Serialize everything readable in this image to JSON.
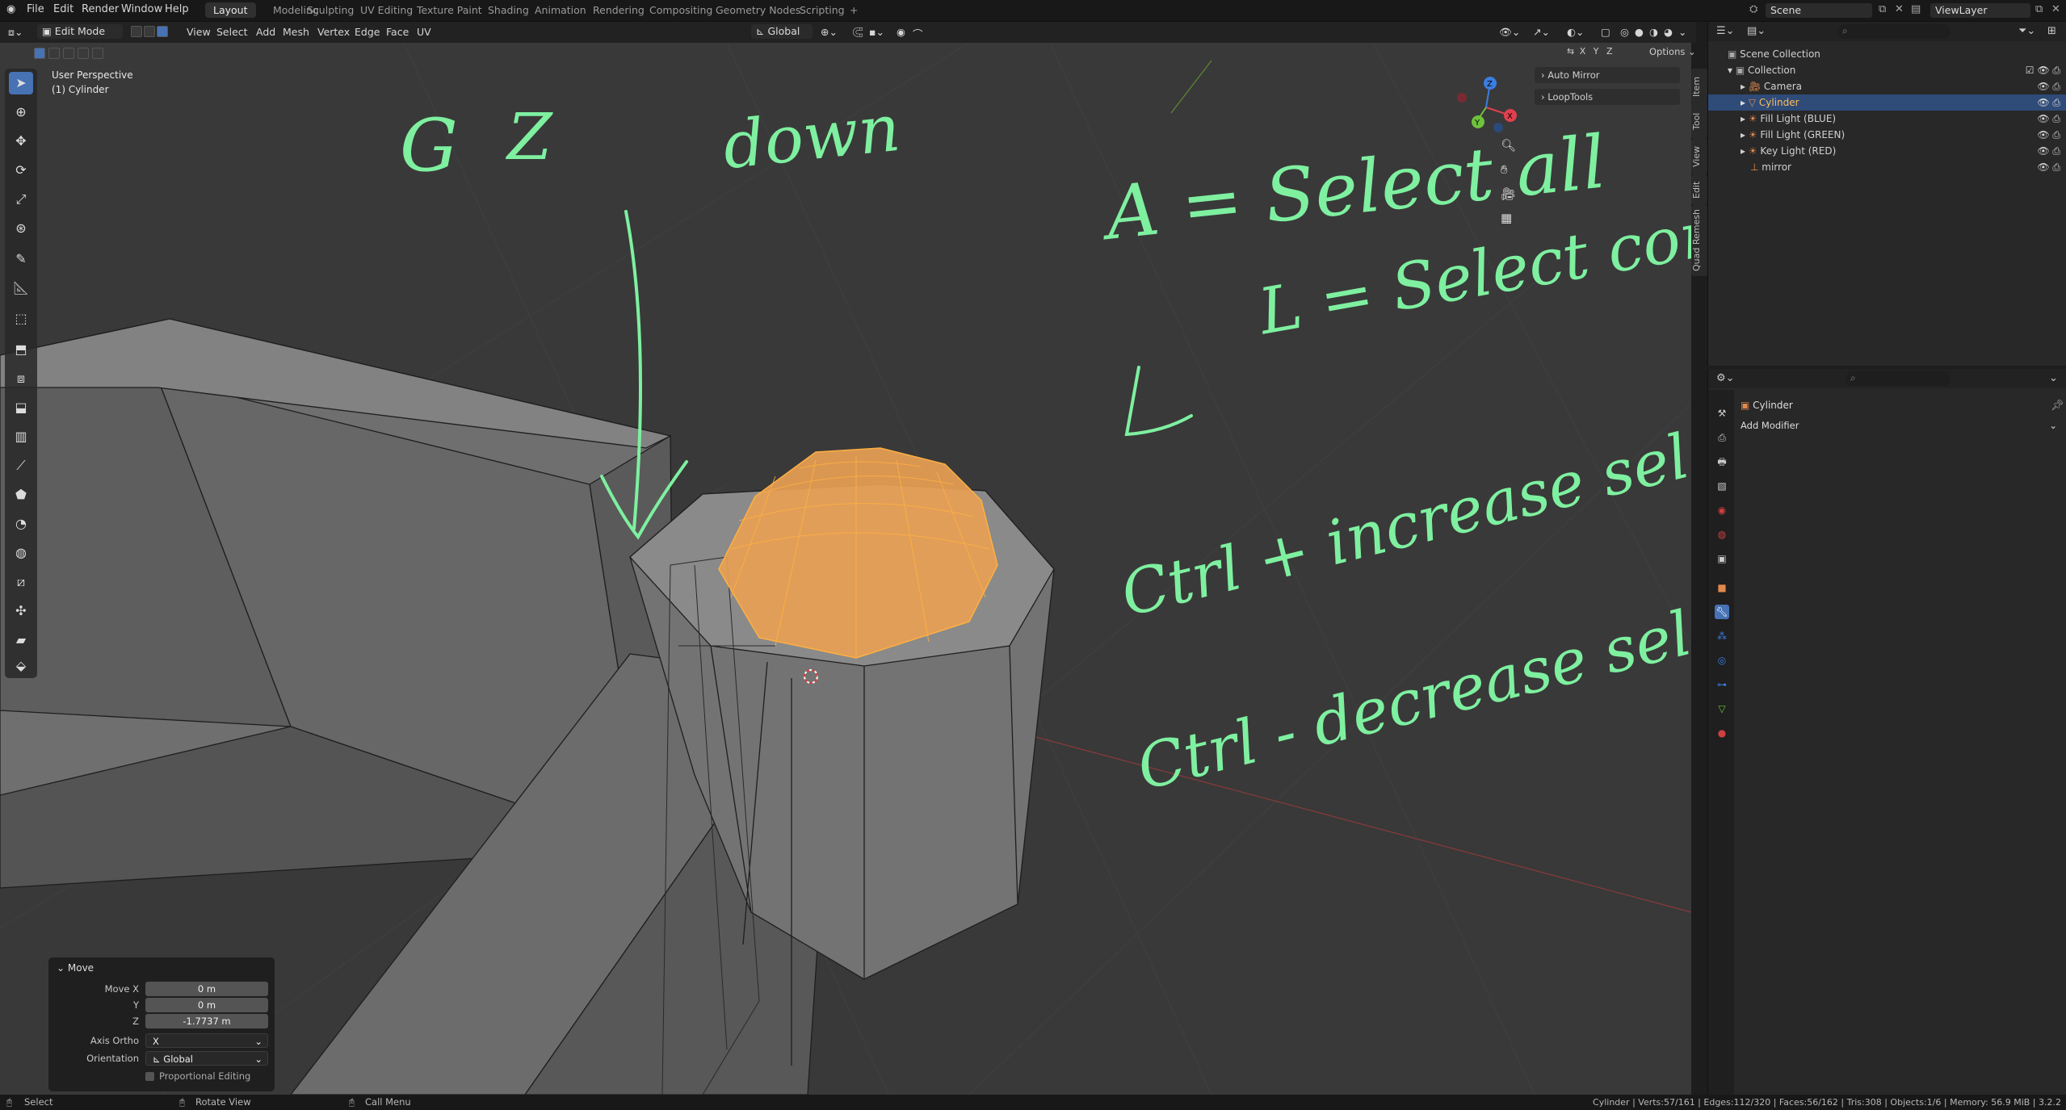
{
  "top_menu": {
    "items": [
      "File",
      "Edit",
      "Render",
      "Window",
      "Help"
    ],
    "workspaces": [
      "Layout",
      "Modeling",
      "Sculpting",
      "UV Editing",
      "Texture Paint",
      "Shading",
      "Animation",
      "Rendering",
      "Compositing",
      "Geometry Nodes",
      "Scripting"
    ],
    "active_workspace": "Layout",
    "add_tab": "+",
    "scene": "Scene",
    "view_layer": "ViewLayer"
  },
  "viewport_header": {
    "mode": "Edit Mode",
    "menus": [
      "View",
      "Select",
      "Add",
      "Mesh",
      "Vertex",
      "Edge",
      "Face",
      "UV"
    ],
    "orientation": "Global",
    "axes": [
      "X",
      "Y",
      "Z"
    ],
    "options_label": "Options"
  },
  "viewport": {
    "perspective_label": "User Perspective",
    "object_label": "(1) Cylinder",
    "side_tabs": [
      "Item",
      "Tool",
      "View",
      "Edit",
      "Quad Remesh"
    ],
    "npanel_items": [
      "Auto Mirror",
      "LoopTools"
    ],
    "gizmo_axes": [
      "X",
      "Y",
      "Z"
    ]
  },
  "annotations": {
    "line1a": "G",
    "line1b": "Z",
    "line1c": "down",
    "line2": "A = Select all",
    "line3": "L = Select connected",
    "line4": "Ctrl + increase selection",
    "line5": "Ctrl - decrease selection"
  },
  "operator_panel": {
    "title": "Move",
    "move_x_label": "Move X",
    "move_x": "0 m",
    "y_label": "Y",
    "y": "0 m",
    "z_label": "Z",
    "z": "-1.7737 m",
    "axis_ortho_label": "Axis Ortho",
    "axis_ortho": "X",
    "orientation_label": "Orientation",
    "orientation": "Global",
    "proportional": "Proportional Editing"
  },
  "outliner": {
    "root": "Scene Collection",
    "collection": "Collection",
    "items": [
      "Camera",
      "Cylinder",
      "Fill Light (BLUE)",
      "Fill Light (GREEN)",
      "Key Light (RED)",
      "mirror"
    ],
    "selected_item": "Cylinder"
  },
  "properties": {
    "object_name": "Cylinder",
    "add_modifier": "Add Modifier"
  },
  "status_bar": {
    "select": "Select",
    "rotate_view": "Rotate View",
    "call_menu": "Call Menu",
    "stats": "Cylinder | Verts:57/161 | Edges:112/320 | Faces:56/162 | Tris:308 | Objects:1/6 | Memory: 56.9 MiB | 3.2.2"
  },
  "colors": {
    "accent": "#4772b3",
    "selection_orange": "#f0a040",
    "annotation_green": "#7ef0a0",
    "axis_x": "#e0404e",
    "axis_y": "#6ec23c",
    "axis_z": "#3a7ee0"
  }
}
